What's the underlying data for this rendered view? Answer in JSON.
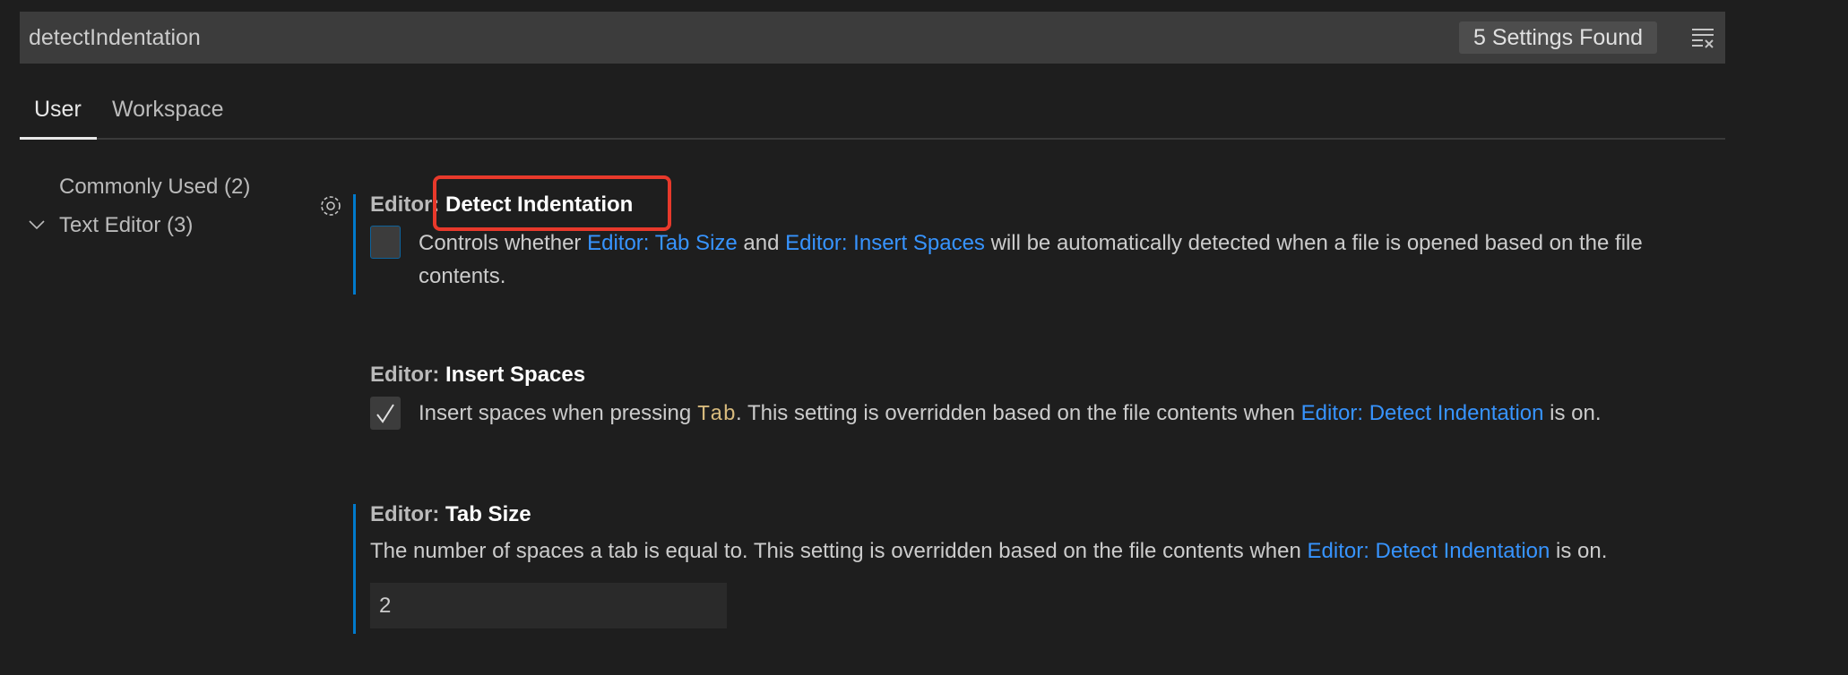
{
  "search": {
    "value": "detectIndentation",
    "results_badge": "5 Settings Found",
    "clear_icon": "clear-filter-icon"
  },
  "tabs": [
    {
      "label": "User",
      "active": true
    },
    {
      "label": "Workspace",
      "active": false
    }
  ],
  "sidebar": {
    "items": [
      {
        "label": "Commonly Used (2)"
      },
      {
        "label": "Text Editor (3)",
        "expanded": true
      }
    ]
  },
  "settings": [
    {
      "category": "Editor: ",
      "name": "Detect Indentation",
      "checked": false,
      "desc": {
        "pre": "Controls whether ",
        "link1": "Editor: Tab Size",
        "mid": " and ",
        "link2": "Editor: Insert Spaces",
        "post1": " will be automatically detected when a file is opened based on the file",
        "post2": "contents."
      }
    },
    {
      "category": "Editor: ",
      "name": "Insert Spaces",
      "checked": true,
      "desc": {
        "pre": "Insert spaces when pressing ",
        "code": "Tab",
        "mid": ". This setting is overridden based on the file contents when ",
        "link": "Editor: Detect Indentation",
        "post": " is on."
      }
    },
    {
      "category": "Editor: ",
      "name": "Tab Size",
      "value": "2",
      "desc": {
        "pre": "The number of spaces a tab is equal to. This setting is overridden based on the file contents when ",
        "link": "Editor: Detect Indentation",
        "post": " is on."
      }
    }
  ],
  "colors": {
    "accent": "#007acc",
    "link": "#3794ff",
    "highlight_box": "#e8392b"
  }
}
